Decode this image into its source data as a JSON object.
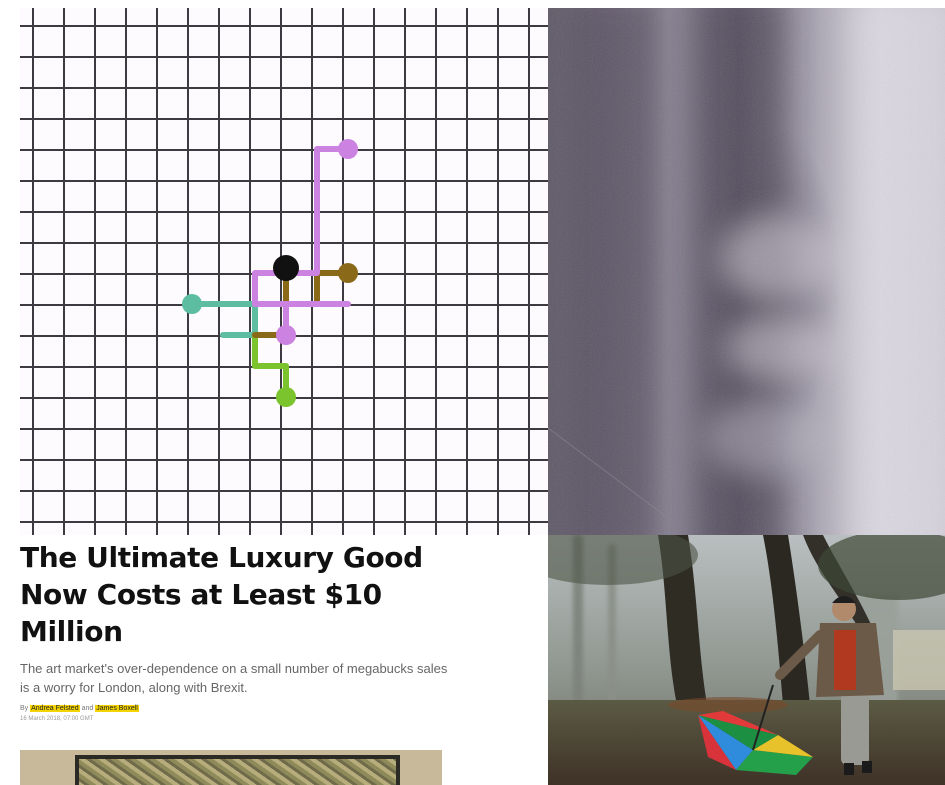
{
  "article": {
    "headline": "The Ultimate Luxury Good Now Costs at Least $10 Million",
    "dek": "The art market's over-dependence on a small number of megabucks sales is a worry for London, along with Brexit.",
    "byline_prefix": "By",
    "author_1": "Andrea Felsted",
    "byline_and": "and",
    "author_2": "James Boxell",
    "date": "16 March 2018, 07:00 GMT"
  },
  "grid_diagram": {
    "colors": {
      "grid": "#3d3a41",
      "background": "#fdfbfe",
      "lilac": "#cc82e0",
      "brown": "#8a6a18",
      "teal": "#5dbda0",
      "green": "#7cc42e",
      "center": "#111111"
    }
  },
  "colors": {
    "text": "#111111",
    "author_highlight": "#f3d400"
  }
}
